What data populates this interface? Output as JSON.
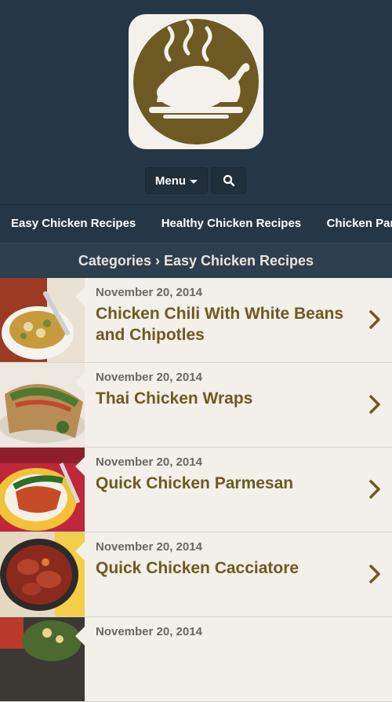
{
  "header": {
    "logo_icon": "roast-chicken-logo-icon",
    "menu_label": "Menu",
    "search_icon": "search-icon"
  },
  "categories_nav": [
    "Easy Chicken Recipes",
    "Healthy Chicken Recipes",
    "Chicken Parmesan"
  ],
  "breadcrumb": {
    "text": "Categories › Easy Chicken Recipes"
  },
  "posts": [
    {
      "date": "November 20, 2014",
      "title": "Chicken Chili With White Beans and Chipotles"
    },
    {
      "date": "November 20, 2014",
      "title": "Thai Chicken Wraps"
    },
    {
      "date": "November 20, 2014",
      "title": "Quick Chicken Parmesan"
    },
    {
      "date": "November 20, 2014",
      "title": "Quick Chicken Cacciatore"
    },
    {
      "date": "November 20, 2014",
      "title": ""
    }
  ],
  "colors": {
    "header_bg": "#253746",
    "accent_olive": "#6d5a22",
    "list_bg": "#f3efe9"
  }
}
